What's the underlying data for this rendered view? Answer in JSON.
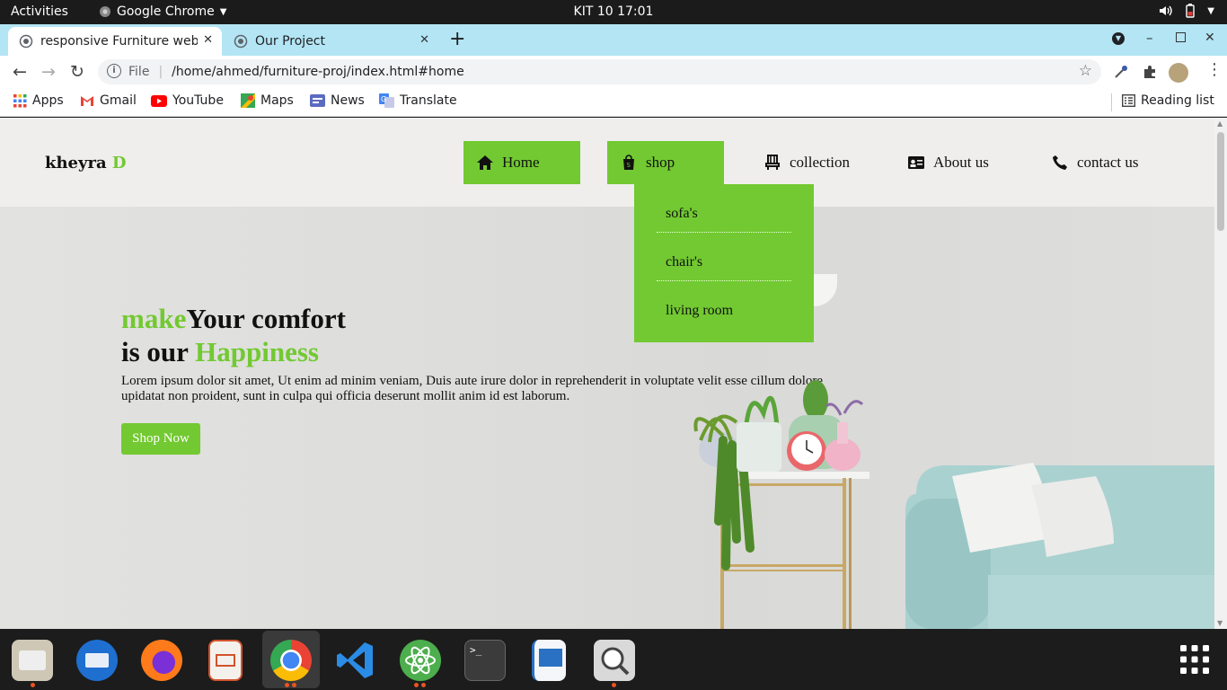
{
  "system": {
    "activities": "Activities",
    "app_menu": "Google Chrome",
    "clock": "KIT 10  17:01"
  },
  "tabs": [
    {
      "title": "responsive Furniture web",
      "active": true
    },
    {
      "title": "Our Project",
      "active": false
    }
  ],
  "toolbar": {
    "scheme_label": "File",
    "url": "/home/ahmed/furniture-proj/index.html#home"
  },
  "bookmarks": {
    "items": [
      {
        "label": "Apps",
        "icon": "apps-grid-icon"
      },
      {
        "label": "Gmail",
        "icon": "gmail-icon"
      },
      {
        "label": "YouTube",
        "icon": "youtube-icon"
      },
      {
        "label": "Maps",
        "icon": "maps-icon"
      },
      {
        "label": "News",
        "icon": "news-icon"
      },
      {
        "label": "Translate",
        "icon": "translate-icon"
      }
    ],
    "reading_list": "Reading list"
  },
  "site": {
    "logo_main": "kheyra ",
    "logo_accent": "D",
    "nav": [
      {
        "label": "Home",
        "icon": "home-icon"
      },
      {
        "label": "shop",
        "icon": "shopping-bag-icon"
      },
      {
        "label": "collection",
        "icon": "chair-icon"
      },
      {
        "label": "About us",
        "icon": "id-card-icon"
      },
      {
        "label": "contact us",
        "icon": "phone-icon"
      }
    ],
    "dropdown": [
      "sofa's",
      "chair's",
      "living room"
    ],
    "hero": {
      "h_make": "make",
      "h_comfort": "Your comfort",
      "h_is": "is our ",
      "h_happiness": "Happiness",
      "paragraph_line1": "Lorem ipsum dolor sit amet, Ut enim ad minim veniam, Duis aute irure dolor in reprehenderit in voluptate velit esse cillum dolore",
      "paragraph_line2": "upidatat non proident, sunt in culpa qui officia deserunt mollit anim id est laborum.",
      "cta": "Shop Now"
    },
    "colors": {
      "accent": "#72c931",
      "text": "#111111"
    }
  },
  "dock": [
    "files-icon",
    "thunderbird-icon",
    "firefox-icon",
    "impress-icon",
    "chrome-icon",
    "vscode-icon",
    "atom-icon",
    "terminal-icon",
    "writer-icon",
    "image-viewer-icon",
    "show-apps-icon"
  ]
}
